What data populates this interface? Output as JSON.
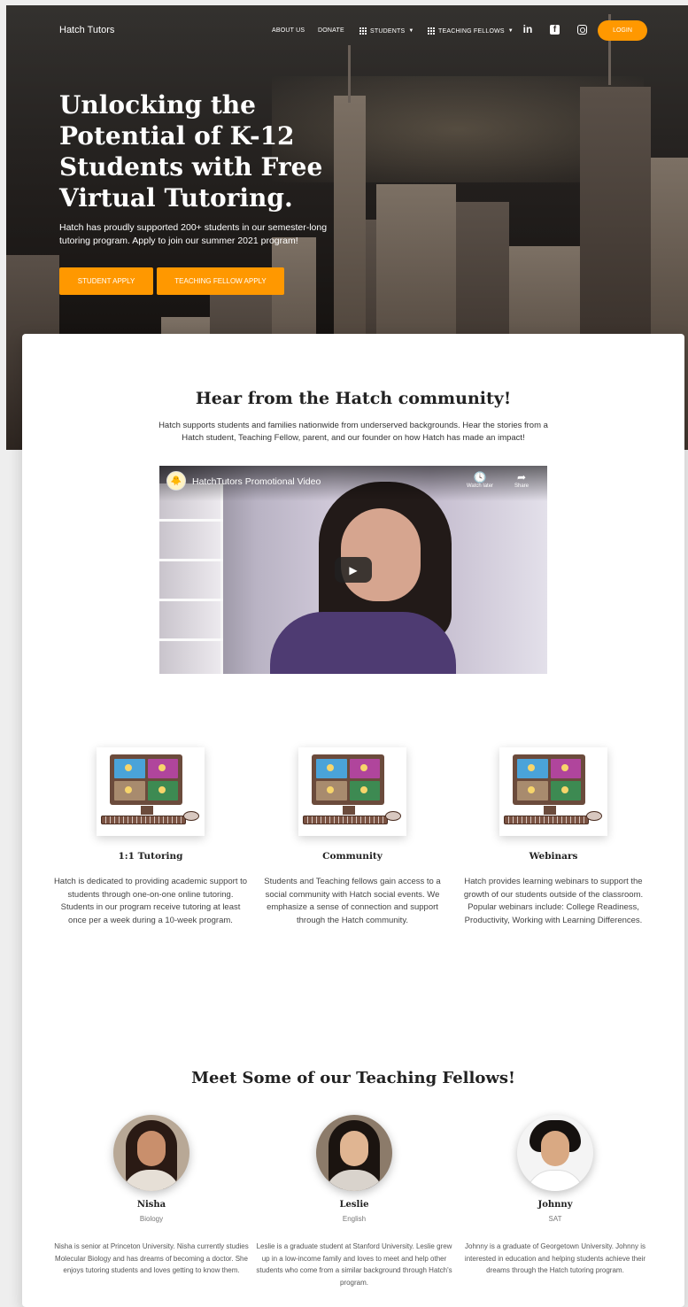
{
  "nav": {
    "brand": "Hatch Tutors",
    "about": "ABOUT US",
    "donate": "DONATE",
    "students": "STUDENTS",
    "fellows": "TEACHING FELLOWS",
    "linkedin_glyph": "in",
    "facebook_glyph": "f",
    "login": "LOGIN"
  },
  "hero": {
    "title": "Unlocking the Potential of K-12 Students with Free Virtual Tutoring.",
    "subtitle": "Hatch has proudly supported 200+ students in our semester-long tutoring program. Apply to join our summer 2021 program!",
    "student_apply": "STUDENT APPLY",
    "fellow_apply": "TEACHING FELLOW APPLY"
  },
  "community": {
    "heading": "Hear from the Hatch community!",
    "text": "Hatch supports students and families nationwide from underserved backgrounds. Hear the stories from a Hatch student, Teaching Fellow, parent, and our founder on how Hatch has made an impact!",
    "video": {
      "title": "HatchTutors Promotional Video",
      "watch_later": "Watch later",
      "share": "Share"
    }
  },
  "features": [
    {
      "title": "1:1 Tutoring",
      "desc": "Hatch is dedicated to providing academic support to students through one-on-one online tutoring. Students in our program receive tutoring at least once per a week during a 10-week program."
    },
    {
      "title": "Community",
      "desc": "Students and Teaching fellows gain access to a social community with Hatch social events. We emphasize a sense of connection and support through the Hatch community."
    },
    {
      "title": "Webinars",
      "desc": "Hatch provides learning webinars to support the growth of our students outside of the classroom. Popular webinars include: College Readiness, Productivity, Working with Learning Differences."
    }
  ],
  "fellows": {
    "heading": "Meet Some of our Teaching Fellows!",
    "people": [
      {
        "name": "Nisha",
        "subject": "Biology",
        "desc": "Nisha is senior at Princeton University. Nisha currently studies Molecular Biology and has dreams of becoming a doctor. She enjoys tutoring students and loves getting to know them."
      },
      {
        "name": "Leslie",
        "subject": "English",
        "desc": "Leslie is a graduate student at Stanford University. Leslie grew up in a low-income family and loves to meet and help other students who come from a similar background through Hatch's program."
      },
      {
        "name": "Johnny",
        "subject": "SAT",
        "desc": "Johnny is a graduate of Georgetown University. Johnny is interested in education and helping students achieve their dreams through the Hatch tutoring program."
      }
    ]
  },
  "colors": {
    "accent": "#ff9800"
  }
}
